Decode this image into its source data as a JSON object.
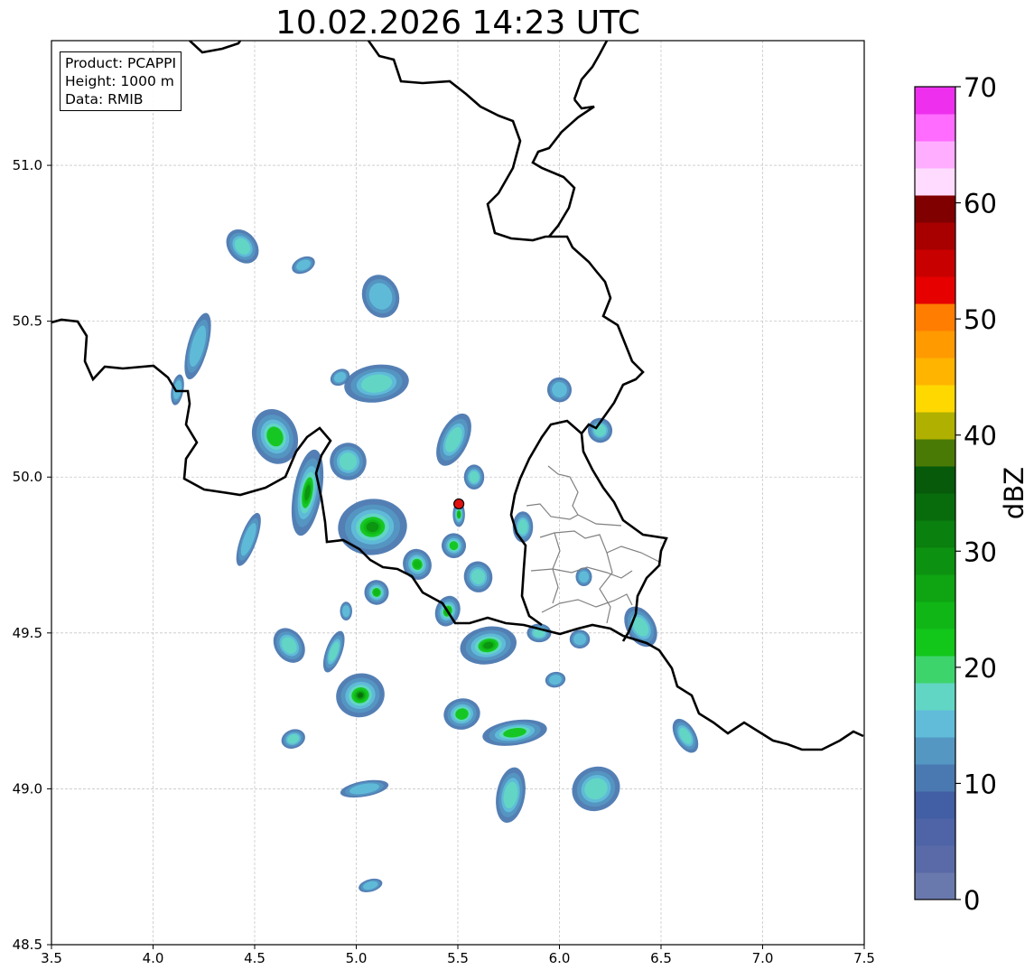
{
  "title": "10.02.2026 14:23 UTC",
  "info": {
    "product": "Product: PCAPPI",
    "height": "Height: 1000 m",
    "data": "Data: RMIB"
  },
  "map": {
    "lon_range": [
      3.5,
      7.5
    ],
    "lat_range": [
      48.5,
      51.4
    ],
    "x_ticks": [
      "3.5",
      "4.0",
      "4.5",
      "5.0",
      "5.5",
      "6.0",
      "6.5",
      "7.0",
      "7.5"
    ],
    "y_ticks": [
      "48.5",
      "49.0",
      "49.5",
      "50.0",
      "50.5",
      "51.0"
    ],
    "grid": true,
    "radar_site": {
      "lon": 5.505,
      "lat": 49.914,
      "color": "#e01010"
    },
    "border_color": "#000000",
    "district_color": "#808080"
  },
  "colorbar": {
    "label": "dBZ",
    "range": [
      0,
      70
    ],
    "step": 2.5,
    "tick_labels": [
      "0",
      "10",
      "20",
      "30",
      "40",
      "50",
      "60",
      "70"
    ],
    "colors": [
      "#6a79ad",
      "#5a6aa8",
      "#4e64a6",
      "#425ea4",
      "#4a78b0",
      "#5497c3",
      "#60bcd9",
      "#62d6c4",
      "#3ed46c",
      "#12c61a",
      "#10b616",
      "#0ea412",
      "#0c9210",
      "#0a800e",
      "#086c0c",
      "#065a0a",
      "#4a7a06",
      "#afb000",
      "#ffd800",
      "#ffb400",
      "#ff9a00",
      "#ff7d00",
      "#e60000",
      "#c80000",
      "#a80000",
      "#800000",
      "#ffdcff",
      "#ffaeff",
      "#ff6cff",
      "#ee30ee"
    ]
  },
  "echoes": [
    {
      "lon": 4.44,
      "lat": 50.74,
      "rx": 0.07,
      "ry": 0.06,
      "rot": -40,
      "i": 0.35
    },
    {
      "lon": 4.74,
      "lat": 50.68,
      "rx": 0.06,
      "ry": 0.025,
      "rot": -25,
      "i": 0.15
    },
    {
      "lon": 5.12,
      "lat": 50.58,
      "rx": 0.09,
      "ry": 0.07,
      "rot": -20,
      "i": 0.1
    },
    {
      "lon": 4.22,
      "lat": 50.42,
      "rx": 0.05,
      "ry": 0.11,
      "rot": 15,
      "i": 0.15
    },
    {
      "lon": 4.12,
      "lat": 50.28,
      "rx": 0.03,
      "ry": 0.05,
      "rot": 10,
      "i": 0.1
    },
    {
      "lon": 5.1,
      "lat": 50.3,
      "rx": 0.16,
      "ry": 0.06,
      "rot": -8,
      "i": 0.3
    },
    {
      "lon": 4.92,
      "lat": 50.32,
      "rx": 0.05,
      "ry": 0.025,
      "rot": -30,
      "i": 0.15
    },
    {
      "lon": 4.6,
      "lat": 50.13,
      "rx": 0.11,
      "ry": 0.09,
      "rot": -20,
      "i": 0.5
    },
    {
      "lon": 4.76,
      "lat": 49.95,
      "rx": 0.07,
      "ry": 0.14,
      "rot": 10,
      "i": 0.75
    },
    {
      "lon": 4.96,
      "lat": 50.05,
      "rx": 0.09,
      "ry": 0.06,
      "rot": -10,
      "i": 0.4
    },
    {
      "lon": 5.08,
      "lat": 49.84,
      "rx": 0.17,
      "ry": 0.09,
      "rot": -5,
      "i": 0.85
    },
    {
      "lon": 5.48,
      "lat": 50.12,
      "rx": 0.07,
      "ry": 0.09,
      "rot": 25,
      "i": 0.3
    },
    {
      "lon": 5.58,
      "lat": 50.0,
      "rx": 0.05,
      "ry": 0.04,
      "rot": 0,
      "i": 0.3
    },
    {
      "lon": 5.505,
      "lat": 49.88,
      "rx": 0.03,
      "ry": 0.04,
      "rot": 0,
      "i": 0.6
    },
    {
      "lon": 5.3,
      "lat": 49.72,
      "rx": 0.07,
      "ry": 0.05,
      "rot": -20,
      "i": 0.6
    },
    {
      "lon": 5.48,
      "lat": 49.78,
      "rx": 0.06,
      "ry": 0.04,
      "rot": -15,
      "i": 0.55
    },
    {
      "lon": 5.6,
      "lat": 49.68,
      "rx": 0.07,
      "ry": 0.05,
      "rot": -10,
      "i": 0.4
    },
    {
      "lon": 5.45,
      "lat": 49.57,
      "rx": 0.06,
      "ry": 0.05,
      "rot": 20,
      "i": 0.6
    },
    {
      "lon": 5.1,
      "lat": 49.63,
      "rx": 0.06,
      "ry": 0.04,
      "rot": -20,
      "i": 0.7
    },
    {
      "lon": 4.95,
      "lat": 49.57,
      "rx": 0.03,
      "ry": 0.03,
      "rot": 0,
      "i": 0.2
    },
    {
      "lon": 4.47,
      "lat": 49.8,
      "rx": 0.04,
      "ry": 0.09,
      "rot": 20,
      "i": 0.15
    },
    {
      "lon": 5.82,
      "lat": 49.84,
      "rx": 0.05,
      "ry": 0.05,
      "rot": 0,
      "i": 0.3
    },
    {
      "lon": 6.0,
      "lat": 50.28,
      "rx": 0.06,
      "ry": 0.04,
      "rot": -20,
      "i": 0.2
    },
    {
      "lon": 6.2,
      "lat": 50.15,
      "rx": 0.06,
      "ry": 0.04,
      "rot": -30,
      "i": 0.25
    },
    {
      "lon": 5.65,
      "lat": 49.46,
      "rx": 0.14,
      "ry": 0.06,
      "rot": -10,
      "i": 0.85
    },
    {
      "lon": 5.9,
      "lat": 49.5,
      "rx": 0.06,
      "ry": 0.03,
      "rot": 0,
      "i": 0.3
    },
    {
      "lon": 6.1,
      "lat": 49.48,
      "rx": 0.05,
      "ry": 0.03,
      "rot": 0,
      "i": 0.2
    },
    {
      "lon": 6.4,
      "lat": 49.52,
      "rx": 0.07,
      "ry": 0.07,
      "rot": -30,
      "i": 0.4
    },
    {
      "lon": 6.12,
      "lat": 49.68,
      "rx": 0.04,
      "ry": 0.03,
      "rot": 0,
      "i": 0.2
    },
    {
      "lon": 4.67,
      "lat": 49.46,
      "rx": 0.07,
      "ry": 0.06,
      "rot": -35,
      "i": 0.3
    },
    {
      "lon": 4.89,
      "lat": 49.44,
      "rx": 0.04,
      "ry": 0.07,
      "rot": 20,
      "i": 0.4
    },
    {
      "lon": 5.02,
      "lat": 49.3,
      "rx": 0.12,
      "ry": 0.07,
      "rot": -15,
      "i": 0.95
    },
    {
      "lon": 5.52,
      "lat": 49.24,
      "rx": 0.09,
      "ry": 0.05,
      "rot": -10,
      "i": 0.55
    },
    {
      "lon": 5.78,
      "lat": 49.18,
      "rx": 0.16,
      "ry": 0.04,
      "rot": -8,
      "i": 0.45
    },
    {
      "lon": 5.98,
      "lat": 49.35,
      "rx": 0.05,
      "ry": 0.025,
      "rot": -10,
      "i": 0.15
    },
    {
      "lon": 4.69,
      "lat": 49.16,
      "rx": 0.06,
      "ry": 0.03,
      "rot": -20,
      "i": 0.25
    },
    {
      "lon": 5.04,
      "lat": 49.0,
      "rx": 0.12,
      "ry": 0.025,
      "rot": -10,
      "i": 0.15
    },
    {
      "lon": 5.76,
      "lat": 48.98,
      "rx": 0.07,
      "ry": 0.09,
      "rot": 10,
      "i": 0.35
    },
    {
      "lon": 6.18,
      "lat": 49.0,
      "rx": 0.12,
      "ry": 0.07,
      "rot": -25,
      "i": 0.4
    },
    {
      "lon": 6.62,
      "lat": 49.17,
      "rx": 0.05,
      "ry": 0.06,
      "rot": -30,
      "i": 0.3
    },
    {
      "lon": 5.07,
      "lat": 48.69,
      "rx": 0.06,
      "ry": 0.02,
      "rot": -15,
      "i": 0.1
    }
  ]
}
